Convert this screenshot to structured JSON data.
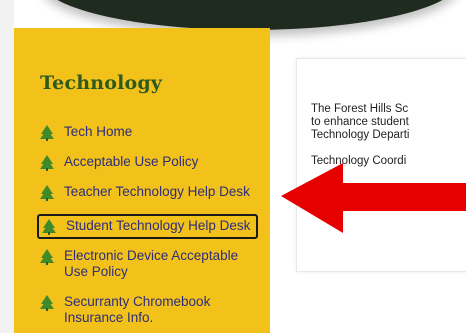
{
  "sidebar": {
    "title": "Technology",
    "items": [
      {
        "label": "Tech Home"
      },
      {
        "label": "Acceptable Use Policy"
      },
      {
        "label": "Teacher Technology Help Desk"
      },
      {
        "label": "Student Technology Help Desk"
      },
      {
        "label": "Electronic Device Acceptable Use Policy"
      },
      {
        "label": "Securranty Chromebook Insurance Info."
      }
    ]
  },
  "content": {
    "line1": "The Forest Hills Sc",
    "line2": "to enhance student",
    "line3": "Technology Departi",
    "line4": "Technology Coordi"
  },
  "colors": {
    "sidebar_bg": "#f2c21a",
    "title_color": "#2f5a1f",
    "link_color": "#2d2d7a",
    "tree_icon": "#3f8a2a",
    "arrow": "#e60000"
  },
  "icons": {
    "nav_bullet": "tree-icon",
    "pointer": "red-arrow-icon"
  }
}
